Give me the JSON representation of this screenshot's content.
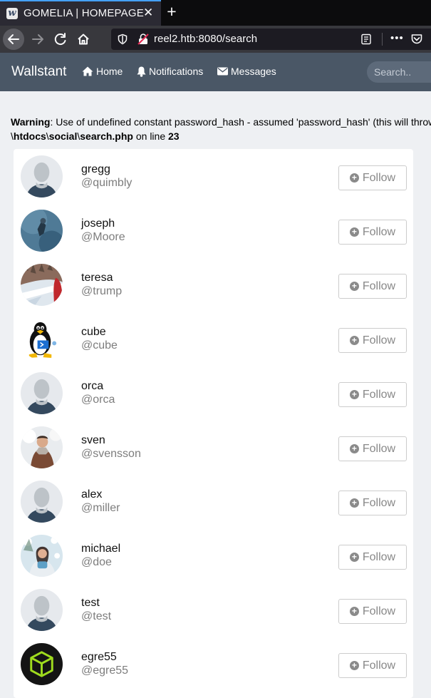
{
  "browser": {
    "tab_title": "GOMELIA | HOMEPAGE",
    "tab_close": "✕",
    "new_tab": "+",
    "url": "reel2.htb:8080/search",
    "more": "•••"
  },
  "site": {
    "brand": "Wallstant",
    "nav": {
      "home": "Home",
      "notifications": "Notifications",
      "messages": "Messages"
    },
    "search_placeholder": "Search.."
  },
  "warning": {
    "label": "Warning",
    "message": ": Use of undefined constant password_hash - assumed 'password_hash' (this will throw an Error in a future version of PHP) in ",
    "path_prefix": "\\",
    "path_parts": [
      "htdocs",
      "social",
      "search.php"
    ],
    "on_line": " on line ",
    "line": "23"
  },
  "users": [
    {
      "name": "gregg",
      "handle": "@quimbly",
      "avatar": "default-avatar",
      "follow_label": "Follow"
    },
    {
      "name": "joseph",
      "handle": "@Moore",
      "avatar": "photo-blue",
      "follow_label": "Follow"
    },
    {
      "name": "teresa",
      "handle": "@trump",
      "avatar": "photo-snow-road",
      "follow_label": "Follow"
    },
    {
      "name": "cube",
      "handle": "@cube",
      "avatar": "tux-penguin",
      "follow_label": "Follow"
    },
    {
      "name": "orca",
      "handle": "@orca",
      "avatar": "default-avatar",
      "follow_label": "Follow"
    },
    {
      "name": "sven",
      "handle": "@svensson",
      "avatar": "photo-winter-man",
      "follow_label": "Follow"
    },
    {
      "name": "alex",
      "handle": "@miller",
      "avatar": "default-avatar",
      "follow_label": "Follow"
    },
    {
      "name": "michael",
      "handle": "@doe",
      "avatar": "photo-winter-woman",
      "follow_label": "Follow"
    },
    {
      "name": "test",
      "handle": "@test",
      "avatar": "default-avatar",
      "follow_label": "Follow"
    },
    {
      "name": "egre55",
      "handle": "@egre55",
      "avatar": "green-cube",
      "follow_label": "Follow"
    }
  ]
}
